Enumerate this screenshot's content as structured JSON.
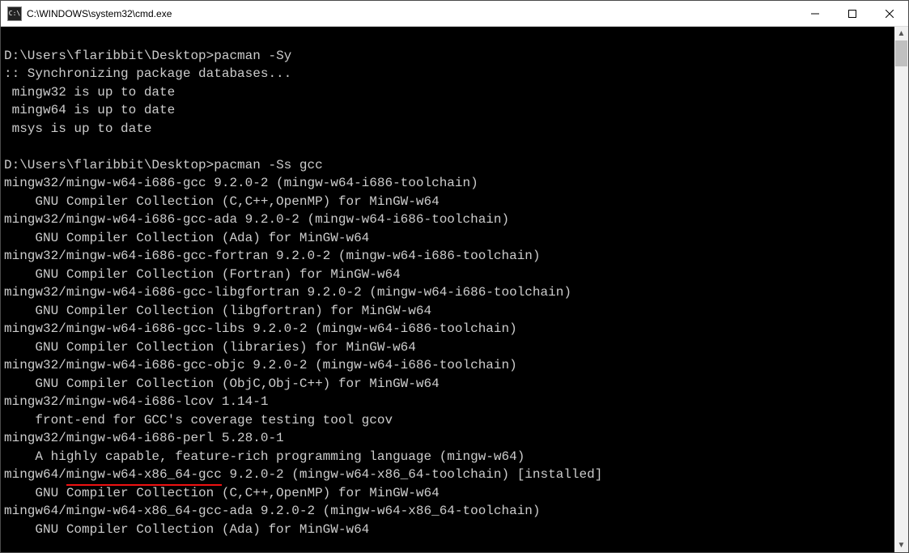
{
  "window": {
    "title": "C:\\WINDOWS\\system32\\cmd.exe",
    "icon_label": "C:\\"
  },
  "prompt": "D:\\Users\\flaribbit\\Desktop>",
  "cmd_sync": "pacman -Sy",
  "sync_header": ":: Synchronizing package databases...",
  "sync_lines": [
    " mingw32 is up to date",
    " mingw64 is up to date",
    " msys is up to date"
  ],
  "cmd_search": "pacman -Ss gcc",
  "packages": [
    {
      "head": "mingw32/mingw-w64-i686-gcc 9.2.0-2 (mingw-w64-i686-toolchain)",
      "desc": "    GNU Compiler Collection (C,C++,OpenMP) for MinGW-w64"
    },
    {
      "head": "mingw32/mingw-w64-i686-gcc-ada 9.2.0-2 (mingw-w64-i686-toolchain)",
      "desc": "    GNU Compiler Collection (Ada) for MinGW-w64"
    },
    {
      "head": "mingw32/mingw-w64-i686-gcc-fortran 9.2.0-2 (mingw-w64-i686-toolchain)",
      "desc": "    GNU Compiler Collection (Fortran) for MinGW-w64"
    },
    {
      "head": "mingw32/mingw-w64-i686-gcc-libgfortran 9.2.0-2 (mingw-w64-i686-toolchain)",
      "desc": "    GNU Compiler Collection (libgfortran) for MinGW-w64"
    },
    {
      "head": "mingw32/mingw-w64-i686-gcc-libs 9.2.0-2 (mingw-w64-i686-toolchain)",
      "desc": "    GNU Compiler Collection (libraries) for MinGW-w64"
    },
    {
      "head": "mingw32/mingw-w64-i686-gcc-objc 9.2.0-2 (mingw-w64-i686-toolchain)",
      "desc": "    GNU Compiler Collection (ObjC,Obj-C++) for MinGW-w64"
    },
    {
      "head": "mingw32/mingw-w64-i686-lcov 1.14-1",
      "desc": "    front-end for GCC's coverage testing tool gcov"
    },
    {
      "head": "mingw32/mingw-w64-i686-perl 5.28.0-1",
      "desc": "    A highly capable, feature-rich programming language (mingw-w64)"
    }
  ],
  "highlighted": {
    "prefix": "mingw64/",
    "name": "mingw-w64-x86_64-gcc",
    "rest": " 9.2.0-2 (mingw-w64-x86_64-toolchain) [installed]",
    "desc": "    GNU Compiler Collection (C,C++,OpenMP) for MinGW-w64"
  },
  "trailing": {
    "head": "mingw64/mingw-w64-x86_64-gcc-ada 9.2.0-2 (mingw-w64-x86_64-toolchain)",
    "desc": "    GNU Compiler Collection (Ada) for MinGW-w64"
  }
}
